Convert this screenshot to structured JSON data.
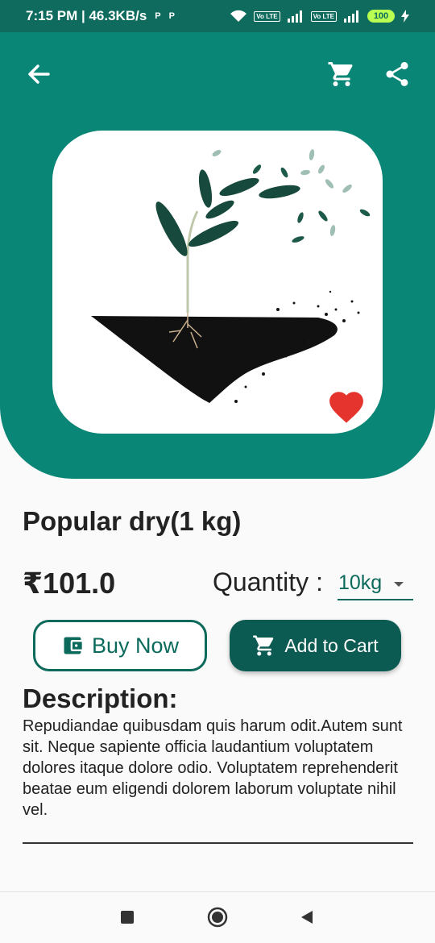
{
  "status_bar": {
    "time_speed": "7:15 PM | 46.3KB/s",
    "p1": "P",
    "p2": "P",
    "sig1": "4G",
    "volte": "Vo LTE",
    "battery": "100"
  },
  "product": {
    "title": "Popular dry(1 kg)",
    "price": "₹101.0",
    "quantity_label": "Quantity :",
    "quantity_value": "10kg"
  },
  "actions": {
    "buy_now": "Buy Now",
    "add_to_cart": "Add to Cart"
  },
  "description": {
    "heading": "Description:",
    "text": "Repudiandae quibusdam quis harum odit.Autem sunt sit. Neque sapiente officia laudantium voluptatem dolores itaque dolore odio. Voluptatem reprehenderit beatae eum eligendi dolorem laborum voluptate nihil vel."
  },
  "colors": {
    "primary": "#0a8676",
    "dark": "#0b5b52",
    "favorite": "#e5342d"
  },
  "icons": [
    "back-arrow-icon",
    "cart-icon",
    "share-icon",
    "heart-icon",
    "wallet-icon",
    "cart-icon"
  ]
}
